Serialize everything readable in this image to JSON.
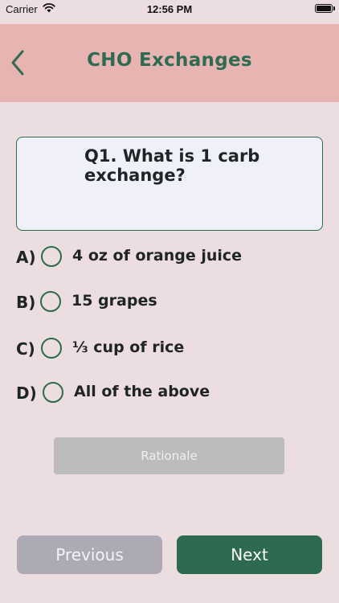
{
  "status_bar": {
    "carrier": "Carrier",
    "time": "12:56 PM",
    "wifi_icon": "wifi-icon",
    "battery_icon": "battery-icon",
    "battery_level": 1.0
  },
  "nav": {
    "back_icon": "chevron-left-icon",
    "title": "CHO Exchanges"
  },
  "question": {
    "text": "Q1. What is 1 carb exchange?"
  },
  "options": [
    {
      "letter": "A)",
      "label": "4 oz of orange juice",
      "selected": false
    },
    {
      "letter": "B)",
      "label": "15 grapes",
      "selected": false
    },
    {
      "letter": "C)",
      "label": "⅓ cup of rice",
      "selected": false
    },
    {
      "letter": "D)",
      "label": "All of the above",
      "selected": false
    }
  ],
  "rationale": {
    "label": "Rationale",
    "enabled": false
  },
  "footer": {
    "previous_label": "Previous",
    "next_label": "Next"
  },
  "colors": {
    "background": "#ecdde1",
    "header": "#e8b4b2",
    "accent": "#2d6a4f",
    "disabled_button": "#bcbcbc",
    "previous_button": "#adaab5"
  }
}
